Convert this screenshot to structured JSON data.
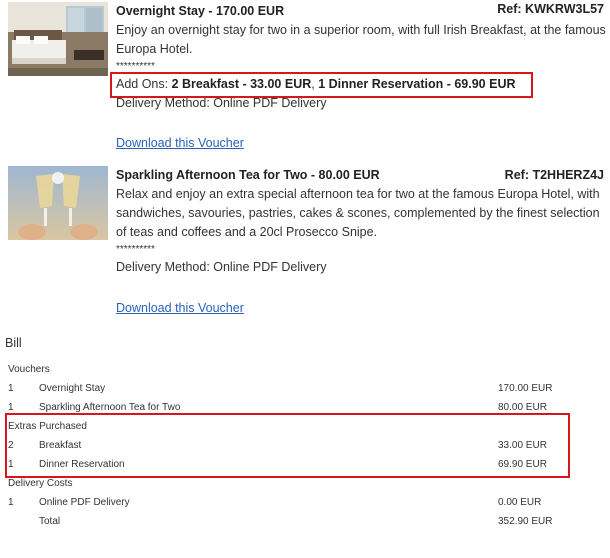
{
  "vouchers": [
    {
      "title": "Overnight Stay - 170.00 EUR",
      "ref": "Ref: KWKRW3L57",
      "description": "Enjoy an overnight stay for two in a superior room, with full Irish Breakfast, at the famous Europa Hotel.",
      "stars": "**********",
      "addons_prefix": "Add Ons: ",
      "addons_item1": "2 Breakfast - 33.00 EUR",
      "addons_sep": ", ",
      "addons_item2": "1 Dinner Reservation - 69.90 EUR",
      "delivery": "Delivery Method: Online PDF Delivery",
      "download": "Download this Voucher"
    },
    {
      "title": "Sparkling Afternoon Tea for Two - 80.00 EUR",
      "ref": "Ref: T2HHERZ4J",
      "description": "Relax and enjoy an extra special afternoon tea for two at the famous Europa Hotel, with sandwiches, savouries, pastries, cakes & scones, complemented by the finest selection of teas and coffees and a 20cl Prosecco Snipe.",
      "stars": "**********",
      "delivery": "Delivery Method: Online PDF Delivery",
      "download": "Download this Voucher"
    }
  ],
  "bill": {
    "title": "Bill",
    "vouchers_heading": "Vouchers",
    "vouchers": [
      {
        "qty": "1",
        "name": "Overnight Stay",
        "price": "170.00 EUR"
      },
      {
        "qty": "1",
        "name": "Sparkling Afternoon Tea for Two",
        "price": "80.00 EUR"
      }
    ],
    "extras_heading": "Extras Purchased",
    "extras": [
      {
        "qty": "2",
        "name": "Breakfast",
        "price": "33.00 EUR"
      },
      {
        "qty": "1",
        "name": "Dinner Reservation",
        "price": "69.90 EUR"
      }
    ],
    "delivery_heading": "Delivery Costs",
    "delivery": [
      {
        "qty": "1",
        "name": "Online PDF Delivery",
        "price": "0.00 EUR"
      }
    ],
    "total_label": "Total",
    "total_price": "352.90 EUR"
  },
  "colors": {
    "link": "#2a62b8",
    "highlight": "#d9161c"
  }
}
